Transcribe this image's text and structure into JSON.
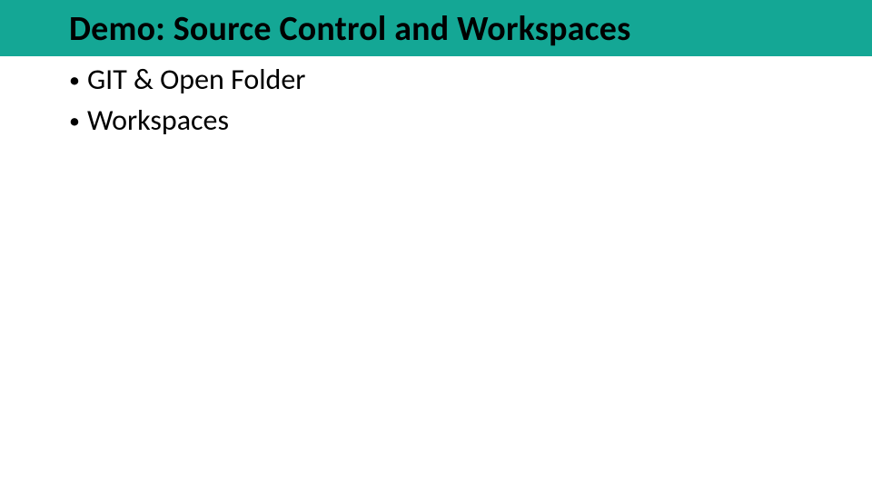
{
  "slide": {
    "title": "Demo: Source Control and Workspaces",
    "bullets": [
      {
        "text": "GIT & Open Folder"
      },
      {
        "text": "Workspaces"
      }
    ],
    "title_bar_color": "#14a795",
    "bullet_marker": "•"
  }
}
